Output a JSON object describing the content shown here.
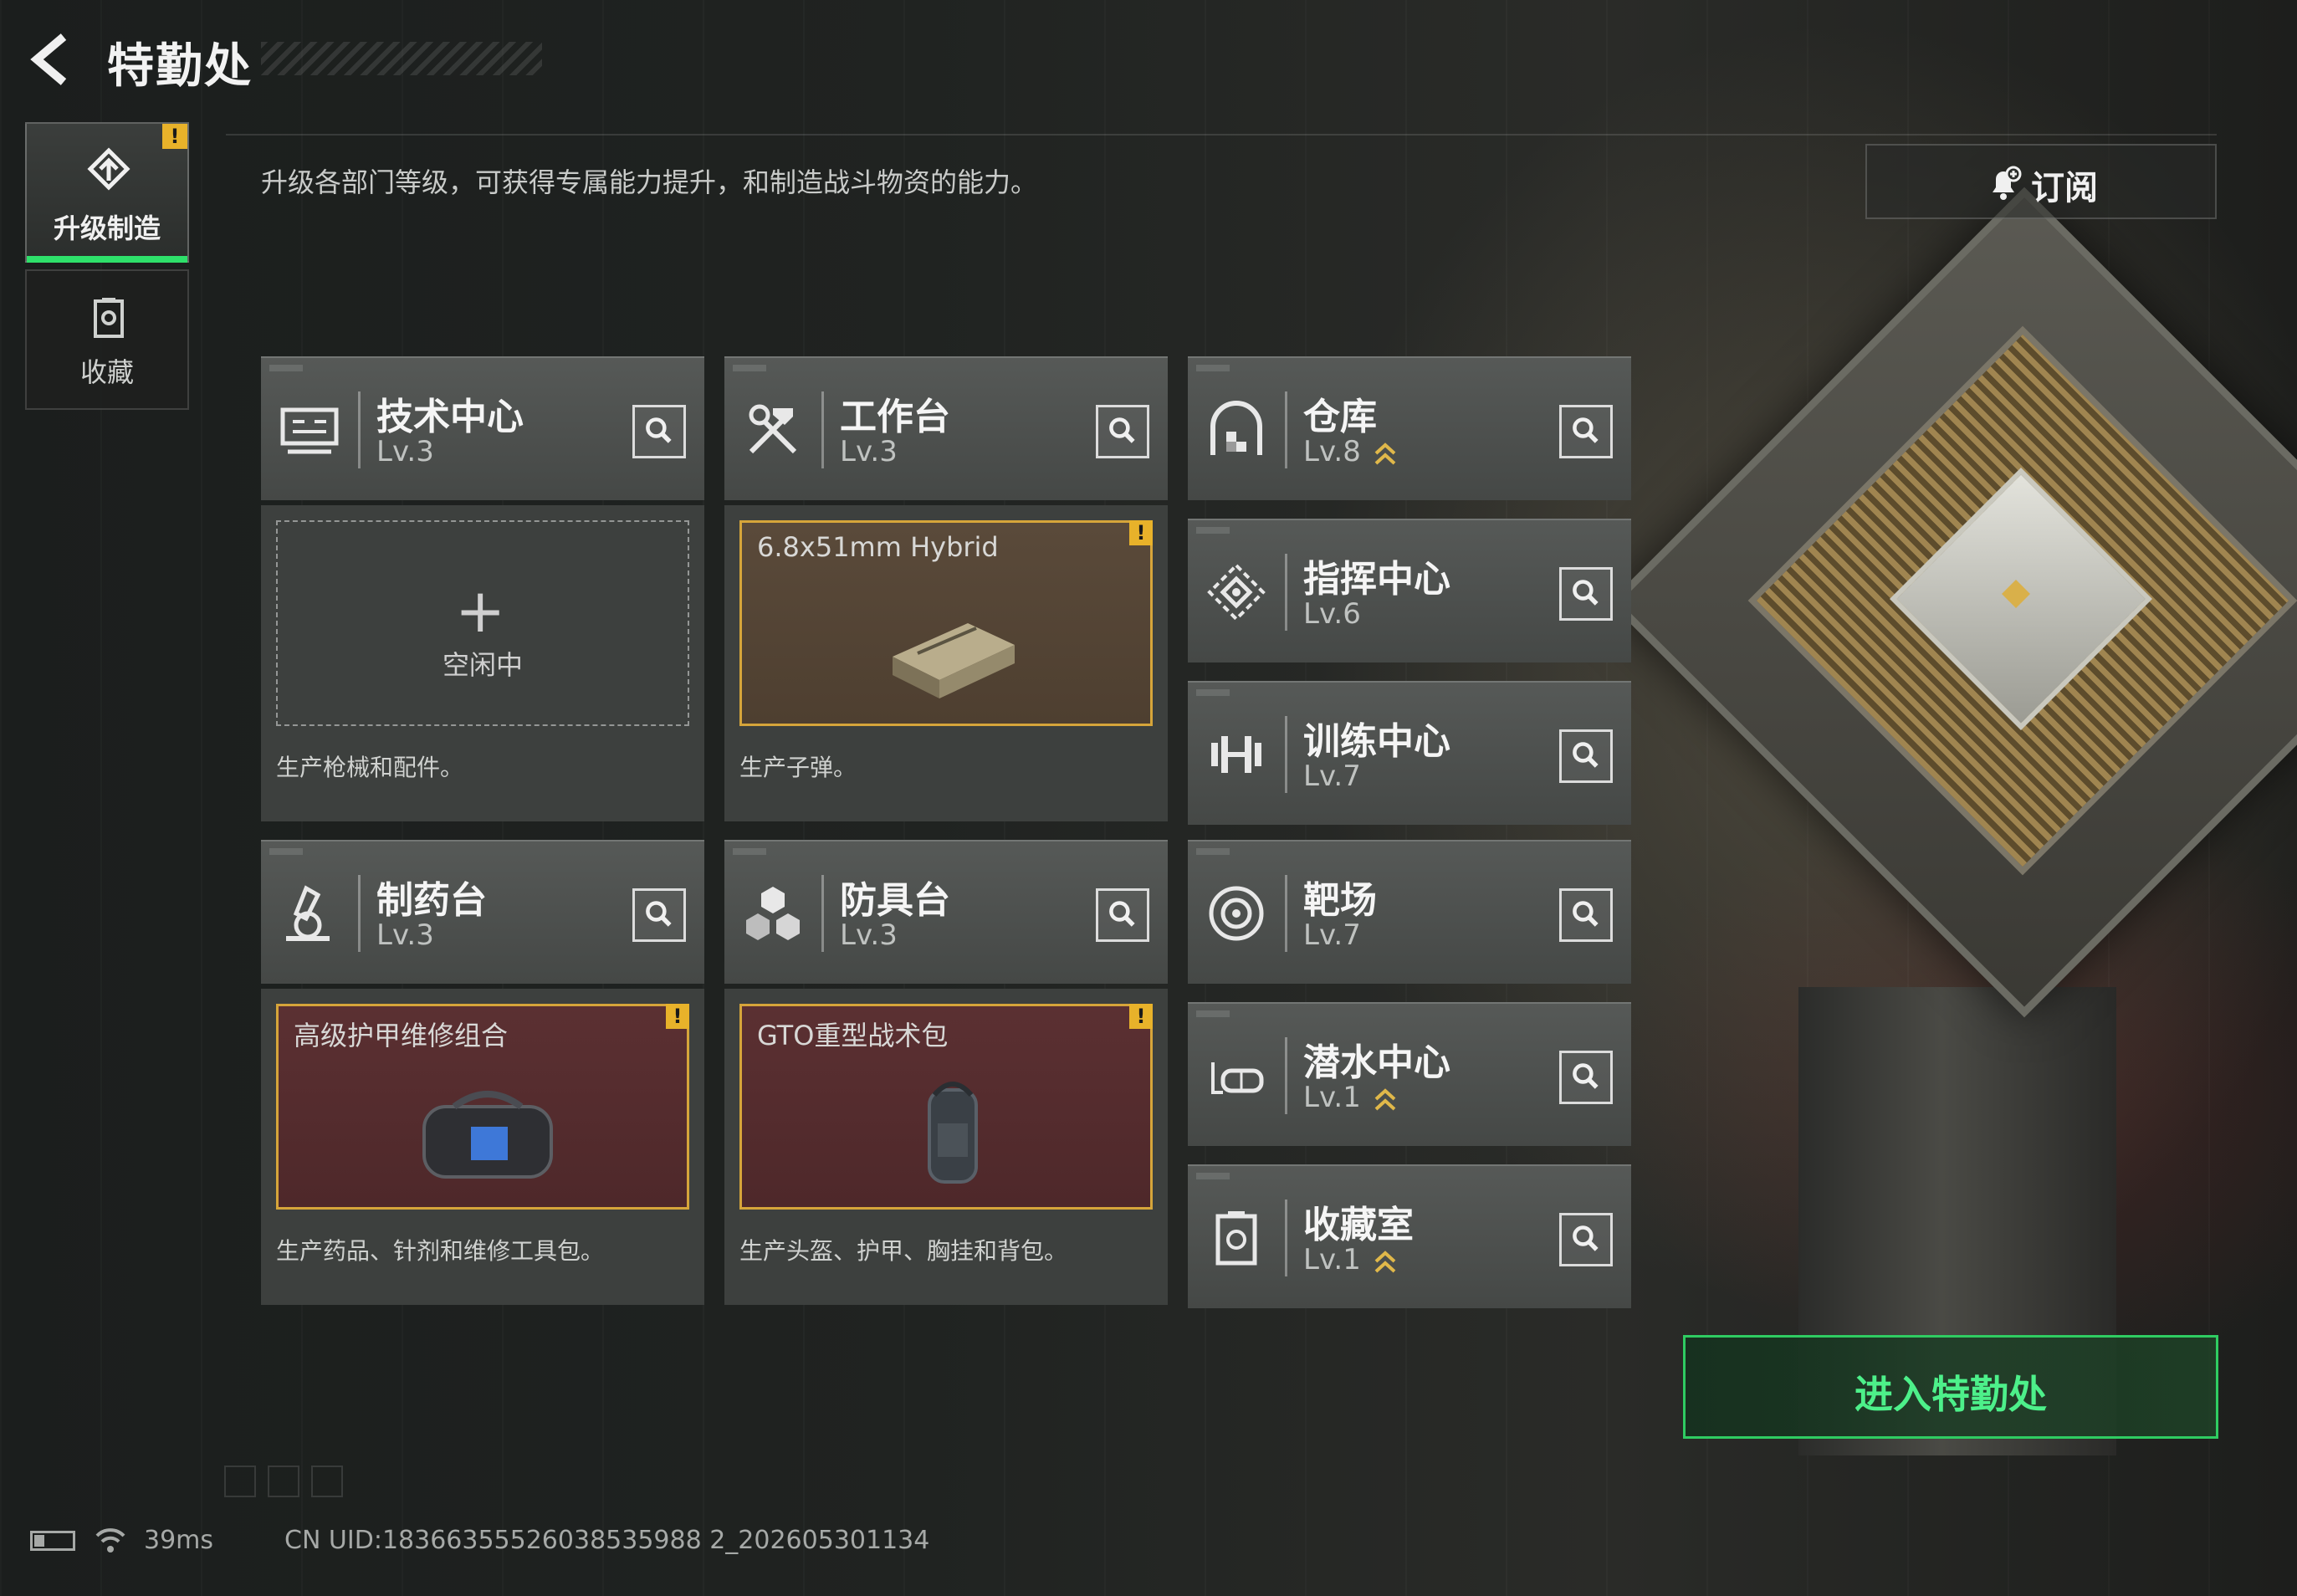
{
  "header": {
    "title": "特勤处",
    "subtitle": "升级各部门等级，可获得专属能力提升，和制造战斗物资的能力。"
  },
  "nav": [
    {
      "label": "升级制造",
      "icon": "upgrade-craft-icon",
      "active": true,
      "alert": "!"
    },
    {
      "label": "收藏",
      "icon": "collection-icon",
      "active": false
    }
  ],
  "subscribe": {
    "label": "订阅",
    "icon": "bell-add-icon"
  },
  "departments": {
    "tech_center": {
      "name": "技术中心",
      "level": "Lv.3",
      "icon": "computer-icon"
    },
    "workbench": {
      "name": "工作台",
      "level": "Lv.3",
      "icon": "hammer-wrench-icon"
    },
    "pharmacy": {
      "name": "制药台",
      "level": "Lv.3",
      "icon": "microscope-icon"
    },
    "armor_bench": {
      "name": "防具台",
      "level": "Lv.3",
      "icon": "cubes-icon"
    },
    "warehouse": {
      "name": "仓库",
      "level": "Lv.8",
      "upgradable": true,
      "icon": "warehouse-icon"
    },
    "command_center": {
      "name": "指挥中心",
      "level": "Lv.6",
      "icon": "command-icon"
    },
    "training_center": {
      "name": "训练中心",
      "level": "Lv.7",
      "icon": "dumbbell-icon"
    },
    "shooting_range": {
      "name": "靶场",
      "level": "Lv.7",
      "icon": "target-icon"
    },
    "diving_center": {
      "name": "潜水中心",
      "level": "Lv.1",
      "upgradable": true,
      "icon": "diving-mask-icon"
    },
    "collection_room": {
      "name": "收藏室",
      "level": "Lv.1",
      "upgradable": true,
      "icon": "collection-room-icon"
    }
  },
  "production": {
    "tech_center": {
      "status": "空闲中",
      "description": "生产枪械和配件。"
    },
    "workbench": {
      "item": "6.8x51mm Hybrid",
      "description": "生产子弹。",
      "alert": "!"
    },
    "pharmacy": {
      "item": "高级护甲维修组合",
      "description": "生产药品、针剂和维修工具包。",
      "alert": "!"
    },
    "armor_bench": {
      "item": "GTO重型战术包",
      "description": "生产头盔、护甲、胸挂和背包。",
      "alert": "!"
    }
  },
  "enter_button": {
    "label": "进入特勤处"
  },
  "status_bar": {
    "ping": "39ms",
    "uid": "CN UID:18366355526038535988 2_202605301134"
  },
  "colors": {
    "accent_green": "#2fcc62",
    "alert_yellow": "#e8b22a",
    "frame_gold": "#d6a53a"
  }
}
